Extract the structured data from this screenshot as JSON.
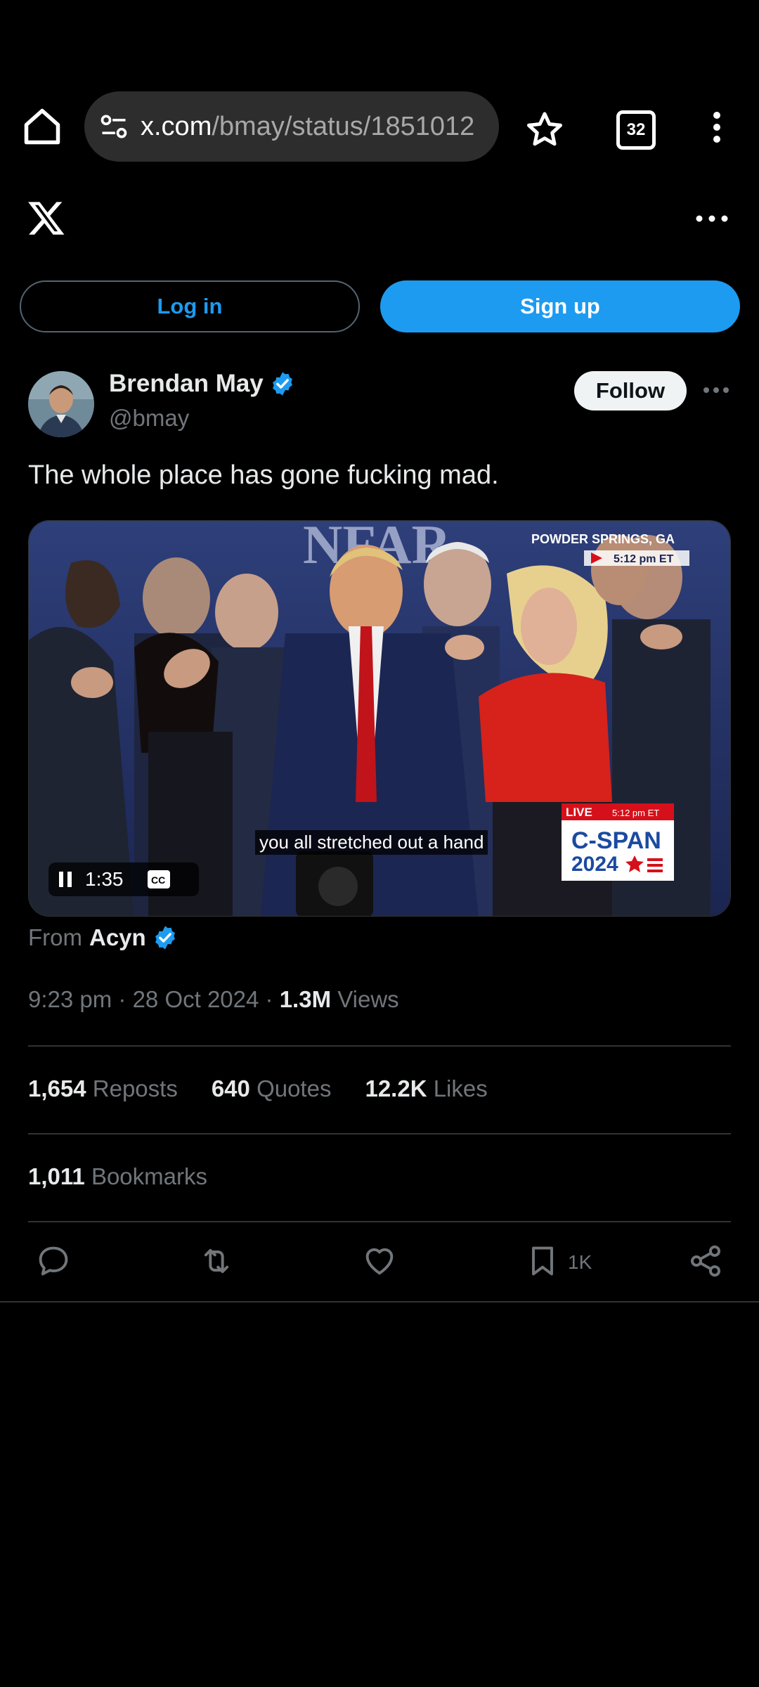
{
  "browser": {
    "url_domain": "x.com",
    "url_path": "/bmay/status/1851012",
    "tab_count": "32",
    "icons": [
      "home-icon",
      "site-settings-icon",
      "star-icon",
      "tabs-icon",
      "more-vert-icon"
    ]
  },
  "header": {
    "logo": "x-logo",
    "more_icon": "more-horiz-icon"
  },
  "auth": {
    "login_label": "Log in",
    "signup_label": "Sign up"
  },
  "tweet": {
    "author_name": "Brendan May",
    "author_handle": "@bmay",
    "follow_label": "Follow",
    "text": "The whole place has gone fucking mad.",
    "video": {
      "caption": "you all stretched out a hand",
      "time": "1:35",
      "overlay_location": "POWDER SPRINGS, GA",
      "overlay_time": "5:12 pm ET",
      "live_label": "LIVE",
      "live_time": "5:12 pm ET",
      "network": "C-SPAN",
      "network_year": "2024"
    },
    "from_prefix": "From",
    "from_source": "Acyn",
    "time": "9:23 pm",
    "date": "28 Oct 2024",
    "views_count": "1.3M",
    "views_label": "Views",
    "reposts_count": "1,654",
    "reposts_label": "Reposts",
    "quotes_count": "640",
    "quotes_label": "Quotes",
    "likes_count": "12.2K",
    "likes_label": "Likes",
    "bookmarks_count": "1,011",
    "bookmarks_label": "Bookmarks",
    "bookmark_short": "1K"
  },
  "colors": {
    "accent": "#1d9bf0",
    "background": "#000000",
    "muted": "#71767b",
    "divider": "#2f3336"
  }
}
